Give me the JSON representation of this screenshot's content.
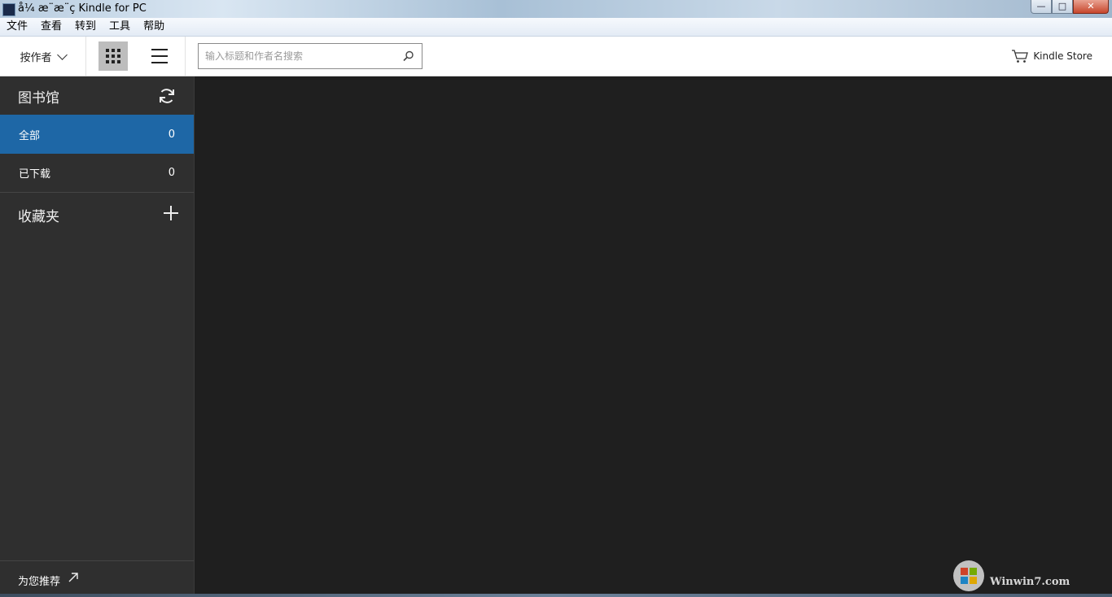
{
  "window": {
    "title": "å¼ æ¨æ¨ç Kindle for PC",
    "minimize_glyph": "—",
    "maximize_glyph": "□",
    "close_glyph": "✕"
  },
  "menubar": {
    "items": [
      "文件",
      "查看",
      "转到",
      "工具",
      "帮助"
    ]
  },
  "toolbar": {
    "sort_label": "按作者",
    "search_placeholder": "输入标题和作者名搜索",
    "store_label": "Kindle Store"
  },
  "sidebar": {
    "library_title": "图书馆",
    "items": [
      {
        "label": "全部",
        "count": "0",
        "active": true
      },
      {
        "label": "已下载",
        "count": "0",
        "active": false
      }
    ],
    "collections_title": "收藏夹",
    "recommend_label": "为您推荐"
  },
  "watermark": {
    "text": "Winwin7.com"
  },
  "colors": {
    "accent": "#1e67a6",
    "sidebar_bg": "#2f2f2f",
    "main_bg": "#1f1f1f"
  }
}
